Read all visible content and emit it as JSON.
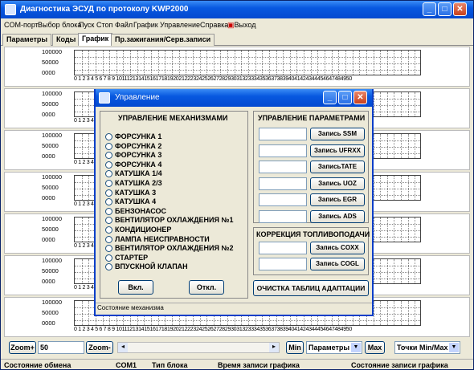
{
  "app": {
    "title": "Диагностика ЭСУД по протоколу KWP2000"
  },
  "menu": [
    "COM-порт",
    "Выбор блока",
    "Пуск",
    "Стоп",
    "Файл",
    "График",
    "Управление",
    "Справка",
    "Выход"
  ],
  "tabs": [
    "Параметры",
    "Коды",
    "График",
    "Пр.зажигания/Серв.записи"
  ],
  "charts": {
    "y_ticks": [
      "100000",
      "50000",
      "0000"
    ],
    "x_ticks": "0 1 2 3 4 5 6 7 8 9 1011121314151617181920212223242526272829303132333435363738394041424344454647484950"
  },
  "dialog": {
    "title": "Управление",
    "left_group_title": "УПРАВЛЕНИЕ МЕХАНИЗМАМИ",
    "mechanisms": [
      "ФОРСУНКА 1",
      "ФОРСУНКА 2",
      "ФОРСУНКА 3",
      "ФОРСУНКА 4",
      "КАТУШКА 1/4",
      "КАТУШКА 2/3",
      "КАТУШКА 3",
      "КАТУШКА 4",
      "БЕНЗОНАСОС",
      "ВЕНТИЛЯТОР ОХЛАЖДЕНИЯ №1",
      "КОНДИЦИОНЕР",
      "ЛАМПА НЕИСПРАВНОСТИ",
      "ВЕНТИЛЯТОР ОХЛАЖДЕНИЯ №2",
      "СТАРТЕР",
      "ВПУСКНОЙ КЛАПАН"
    ],
    "on_label": "Вкл.",
    "off_label": "Откл.",
    "params_group_title": "УПРАВЛЕНИЕ ПАРАМЕТРАМИ",
    "param_buttons": [
      "Запись SSM",
      "Запись UFRXX",
      "ЗаписьTATE",
      "Запись UOZ",
      "Запись EGR",
      "Запись ADS"
    ],
    "fuel_group_title": "КОРРЕКЦИЯ ТОПЛИВОПОДАЧИ",
    "fuel_buttons": [
      "Запись COXX",
      "Запись COGL"
    ],
    "clear_label": "ОЧИСТКА ТАБЛИЦ АДАПТАЦИИ",
    "status": "Состояние механизма"
  },
  "bottom": {
    "zoom_plus": "Zoom+",
    "zoom_value": "50",
    "zoom_minus": "Zoom-",
    "min": "Min",
    "params": "Параметры",
    "max": "Max",
    "points": "Точки Min/Max"
  },
  "status": {
    "exchange": "Состояние обмена",
    "port": "COM1",
    "block_type": "Тип блока",
    "record_time": "Время записи графика",
    "record_state": "Состояние записи графика"
  }
}
